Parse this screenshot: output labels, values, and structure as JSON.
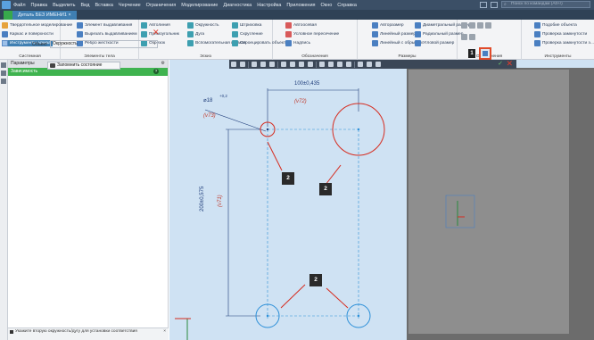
{
  "menubar": {
    "items": [
      "Файл",
      "Правка",
      "Выделить",
      "Вид",
      "Вставка",
      "Черчение",
      "Ограничения",
      "Моделирование",
      "Диагностика",
      "Настройка",
      "Приложения",
      "Окно",
      "Справка"
    ],
    "search_placeholder": "Поиск по командам (Alt+/)"
  },
  "document_tab": {
    "label": "Деталь БЕЗ ИМЕНИ1 ×"
  },
  "ribbon": {
    "group_names": [
      "Системная",
      "Элементы тела",
      "Эскиз",
      "Обозначения",
      "Вставка",
      "Размеры",
      "Ограничения",
      "Диагностика",
      "Инструменты"
    ],
    "items": [
      {
        "label": "Твердотельное моделирование",
        "icon": "solid-model-icon"
      },
      {
        "label": "Каркас и поверхности",
        "icon": "wireframe-icon"
      },
      {
        "label": "Инструменты эскиза",
        "icon": "sketch-tools-icon"
      },
      {
        "label": "Элемент выдавливания",
        "icon": "extrude-icon"
      },
      {
        "label": "Вырезать выдавливанием",
        "icon": "cut-extrude-icon"
      },
      {
        "label": "Ребро жесткости",
        "icon": "rib-icon"
      },
      {
        "label": "Автолиния",
        "icon": "autoline-icon"
      },
      {
        "label": "Прямоугольник",
        "icon": "rectangle-icon"
      },
      {
        "label": "Отрезок",
        "icon": "segment-icon"
      },
      {
        "label": "Окружность",
        "icon": "circle-icon"
      },
      {
        "label": "Дуга",
        "icon": "arc-icon"
      },
      {
        "label": "Вспомогательная прямая",
        "icon": "aux-line-icon"
      },
      {
        "label": "Штриховка",
        "icon": "hatch-icon"
      },
      {
        "label": "Скругление",
        "icon": "fillet-icon"
      },
      {
        "label": "Спроецировать объект",
        "icon": "project-icon"
      },
      {
        "label": "Автоосевая",
        "icon": "auto-axis-icon"
      },
      {
        "label": "Условное пересечение",
        "icon": "intersection-icon"
      },
      {
        "label": "Надпись",
        "icon": "label-icon"
      },
      {
        "label": "Авторазмер",
        "icon": "auto-dim-icon"
      },
      {
        "label": "Линейный размер",
        "icon": "linear-dim-icon"
      },
      {
        "label": "Линейный с обрывом",
        "icon": "linear-break-icon"
      },
      {
        "label": "Диаметральный размер",
        "icon": "diameter-icon"
      },
      {
        "label": "Радиальный размер",
        "icon": "radial-icon"
      },
      {
        "label": "Угловой размер",
        "icon": "angular-icon"
      },
      {
        "label": "Подобие объекта",
        "icon": "similarity-icon"
      },
      {
        "label": "Проверка замкнутости",
        "icon": "closure-check-icon"
      },
      {
        "label": "Проверка замкнутости э...",
        "icon": "closure-check2-icon"
      }
    ],
    "marker_label": "1"
  },
  "panel": {
    "title": "Параметры",
    "subtitle": "Зависимость",
    "object_label": "Объект",
    "object_value": "Окружность",
    "remember_button": "Запомнить состояние",
    "status_hint": "Укажите вторую окружность/дугу для установки соответствия",
    "side_icons": [
      "params-icon",
      "fx-icon",
      "list-icon"
    ]
  },
  "drawing": {
    "dim_horizontal": "100±0,435",
    "dim_horizontal_var": "(v72)",
    "dim_diameter": "⌀18",
    "dim_diameter_tol": "+0,2",
    "dim_diameter_var": "(v73)",
    "dim_vertical": "200±0,575",
    "dim_vertical_var": "(v71)",
    "markers": [
      "2",
      "2",
      "2"
    ]
  },
  "colors": {
    "accent_red": "#d62b1e",
    "construction_blue": "#2b8fd8",
    "canvas_bg": "#cfe2f3"
  }
}
